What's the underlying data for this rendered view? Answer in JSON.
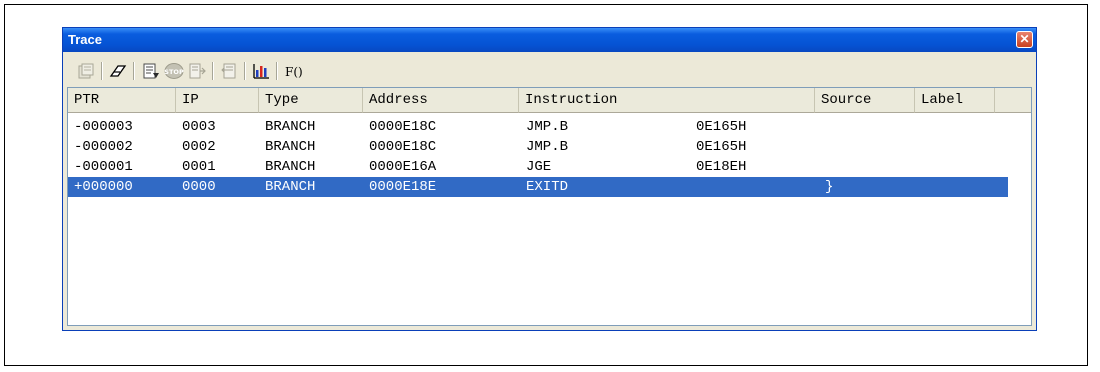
{
  "window": {
    "title": "Trace"
  },
  "toolbar": {
    "function_label": "F()"
  },
  "columns": [
    "PTR",
    "IP",
    "Type",
    "Address",
    "Instruction",
    "Source",
    "Label"
  ],
  "rows": [
    {
      "ptr": "-000003",
      "ip": "0003",
      "type": "BRANCH",
      "address": "0000E18C",
      "mnemonic": "JMP.B",
      "operand": "0E165H",
      "source": ""
    },
    {
      "ptr": "-000002",
      "ip": "0002",
      "type": "BRANCH",
      "address": "0000E18C",
      "mnemonic": "JMP.B",
      "operand": "0E165H",
      "source": ""
    },
    {
      "ptr": "-000001",
      "ip": "0001",
      "type": "BRANCH",
      "address": "0000E16A",
      "mnemonic": "JGE",
      "operand": "0E18EH",
      "source": ""
    },
    {
      "ptr": "+000000",
      "ip": "0000",
      "type": "BRANCH",
      "address": "0000E18E",
      "mnemonic": "EXITD",
      "operand": "",
      "source": "}"
    }
  ],
  "selected_row_index": 3,
  "colors": {
    "title_bar": "#0553d4",
    "selection": "#316ac5",
    "chrome": "#ece9d8"
  }
}
